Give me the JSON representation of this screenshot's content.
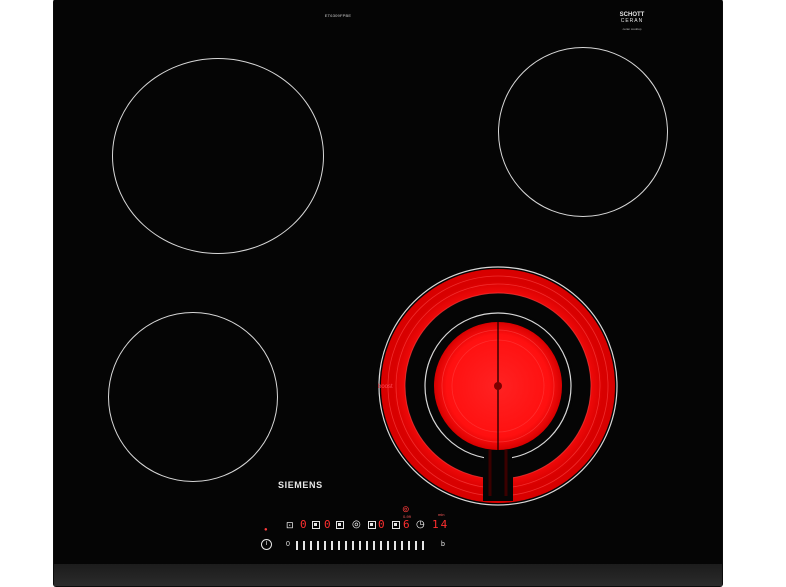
{
  "appliance": {
    "brand": "SIEMENS",
    "model_code": "ET6309FPBE",
    "glass_brand": {
      "line1": "SCHOTT",
      "line2": "CERAN",
      "line3": "ceran cooktop"
    }
  },
  "zones": {
    "front_right": {
      "state": "heating",
      "boost_label": "boost",
      "glow_color": "#ff1a1a"
    }
  },
  "controls": {
    "zone_displays": [
      "0",
      "0",
      "0",
      "6"
    ],
    "timer_display": "14",
    "timer_unit": "min",
    "timer_caption": "0-99",
    "slider_min_label": "0",
    "slider_max_label": "b",
    "slider_steps": 19,
    "icons": [
      "power-icon",
      "child-lock-icon",
      "zone-select-icon",
      "timer-icon",
      "clock-icon"
    ]
  },
  "colors": {
    "glass": "#050505",
    "print": "#d8d8d8",
    "display": "#ff2f2f",
    "heat": "#ff1a1a"
  }
}
